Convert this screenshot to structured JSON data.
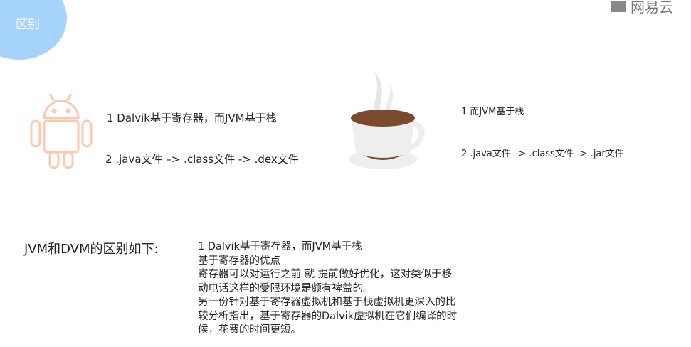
{
  "header": {
    "section_title": "区别",
    "logo_text": "网易云"
  },
  "dalvik": {
    "point1": "1  Dalvik基于寄存器，而JVM基于栈",
    "point2": "2  .java文件 –> .class文件 -> .dex文件"
  },
  "jvm": {
    "point1": "1  而JVM基于栈",
    "point2": "2  .java文件 –> .class文件 -> .jar文件"
  },
  "summary": {
    "heading": "JVM和DVM的区别如下:",
    "lines": [
      "1  Dalvik基于寄存器，而JVM基于栈",
      "基于寄存器的优点",
      "寄存器可以对运行之前 就 提前做好优化，这对类似于移",
      "动电话这样的受限环境是颇有裨益的。",
      "另一份针对基于寄存器虚拟机和基于栈虚拟机更深入的比",
      "较分析指出，基于寄存器的Dalvik虚拟机在它们编译的时",
      "候，花费的时间更短。"
    ]
  },
  "colors": {
    "accent": "#a6d3fb",
    "android": "#fcc9b0",
    "coffee": "#7a4a2e"
  }
}
